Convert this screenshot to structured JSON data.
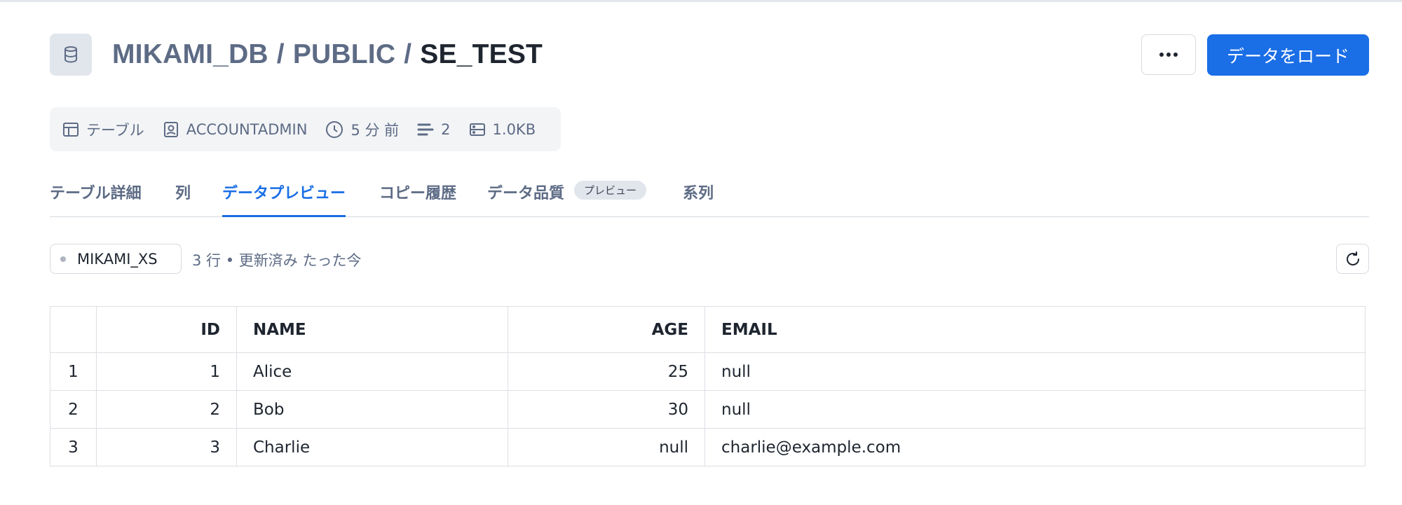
{
  "header": {
    "breadcrumb": {
      "database": "MIKAMI_DB",
      "sep1": "/",
      "schema": "PUBLIC",
      "sep2": "/",
      "table": "SE_TEST"
    },
    "icon": "database-icon",
    "more_icon": "ellipsis-icon",
    "load_button_label": "データをロード"
  },
  "meta": {
    "type": {
      "icon": "table-icon",
      "label": "テーブル"
    },
    "owner": {
      "icon": "user-icon",
      "label": "ACCOUNTADMIN"
    },
    "updated": {
      "icon": "clock-icon",
      "label": "5 分 前"
    },
    "rows": {
      "icon": "rows-icon",
      "label": "2"
    },
    "size": {
      "icon": "storage-icon",
      "label": "1.0KB"
    }
  },
  "tabs": [
    {
      "label": "テーブル詳細",
      "active": false
    },
    {
      "label": "列",
      "active": false
    },
    {
      "label": "データプレビュー",
      "active": true
    },
    {
      "label": "コピー履歴",
      "active": false
    },
    {
      "label": "データ品質",
      "active": false,
      "badge": "プレビュー"
    },
    {
      "label": "系列",
      "active": false
    }
  ],
  "toolbar": {
    "warehouse": "MIKAMI_XS",
    "row_info": "3 行 • 更新済み たった今",
    "refresh_icon": "refresh-icon"
  },
  "table": {
    "columns": [
      "",
      "ID",
      "NAME",
      "AGE",
      "EMAIL"
    ],
    "rows": [
      [
        "1",
        "1",
        "Alice",
        "25",
        "null"
      ],
      [
        "2",
        "2",
        "Bob",
        "30",
        "null"
      ],
      [
        "3",
        "3",
        "Charlie",
        "null",
        "charlie@example.com"
      ]
    ]
  },
  "colors": {
    "accent": "#1a6ee6",
    "muted_text": "#5d6b85"
  }
}
